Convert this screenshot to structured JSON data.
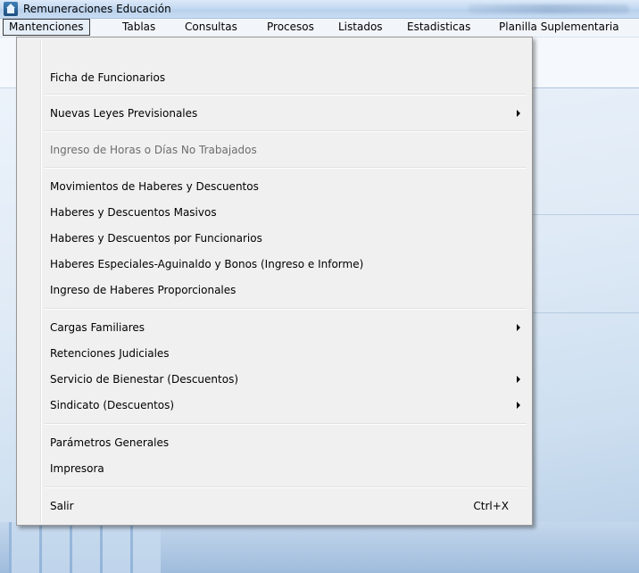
{
  "window": {
    "title": "Remuneraciones Educación",
    "icon": "app-icon"
  },
  "menubar": [
    "Mantenciones",
    "Tablas",
    "Consultas",
    "Procesos",
    "Listados",
    "Estadisticas",
    "Planilla Suplementaria"
  ],
  "menu": {
    "items": [
      {
        "label": "Ficha de Funcionarios"
      },
      {
        "label": "Nuevas Leyes Previsionales",
        "submenu": true
      },
      {
        "label": "Ingreso de Horas o Días No Trabajados",
        "disabled": true
      },
      {
        "label": "Movimientos de Haberes y Descuentos"
      },
      {
        "label": "Haberes y Descuentos Masivos"
      },
      {
        "label": "Haberes y Descuentos por Funcionarios"
      },
      {
        "label": "Haberes Especiales-Aguinaldo y Bonos (Ingreso e Informe)"
      },
      {
        "label": "Ingreso de Haberes Proporcionales"
      },
      {
        "label": "Cargas Familiares",
        "submenu": true
      },
      {
        "label": "Retenciones Judiciales"
      },
      {
        "label": "Servicio de Bienestar (Descuentos)",
        "submenu": true
      },
      {
        "label": "Sindicato (Descuentos)",
        "submenu": true
      },
      {
        "label": "Parámetros Generales"
      },
      {
        "label": "Impresora"
      },
      {
        "label": "Salir",
        "shortcut": "Ctrl+X"
      }
    ]
  }
}
